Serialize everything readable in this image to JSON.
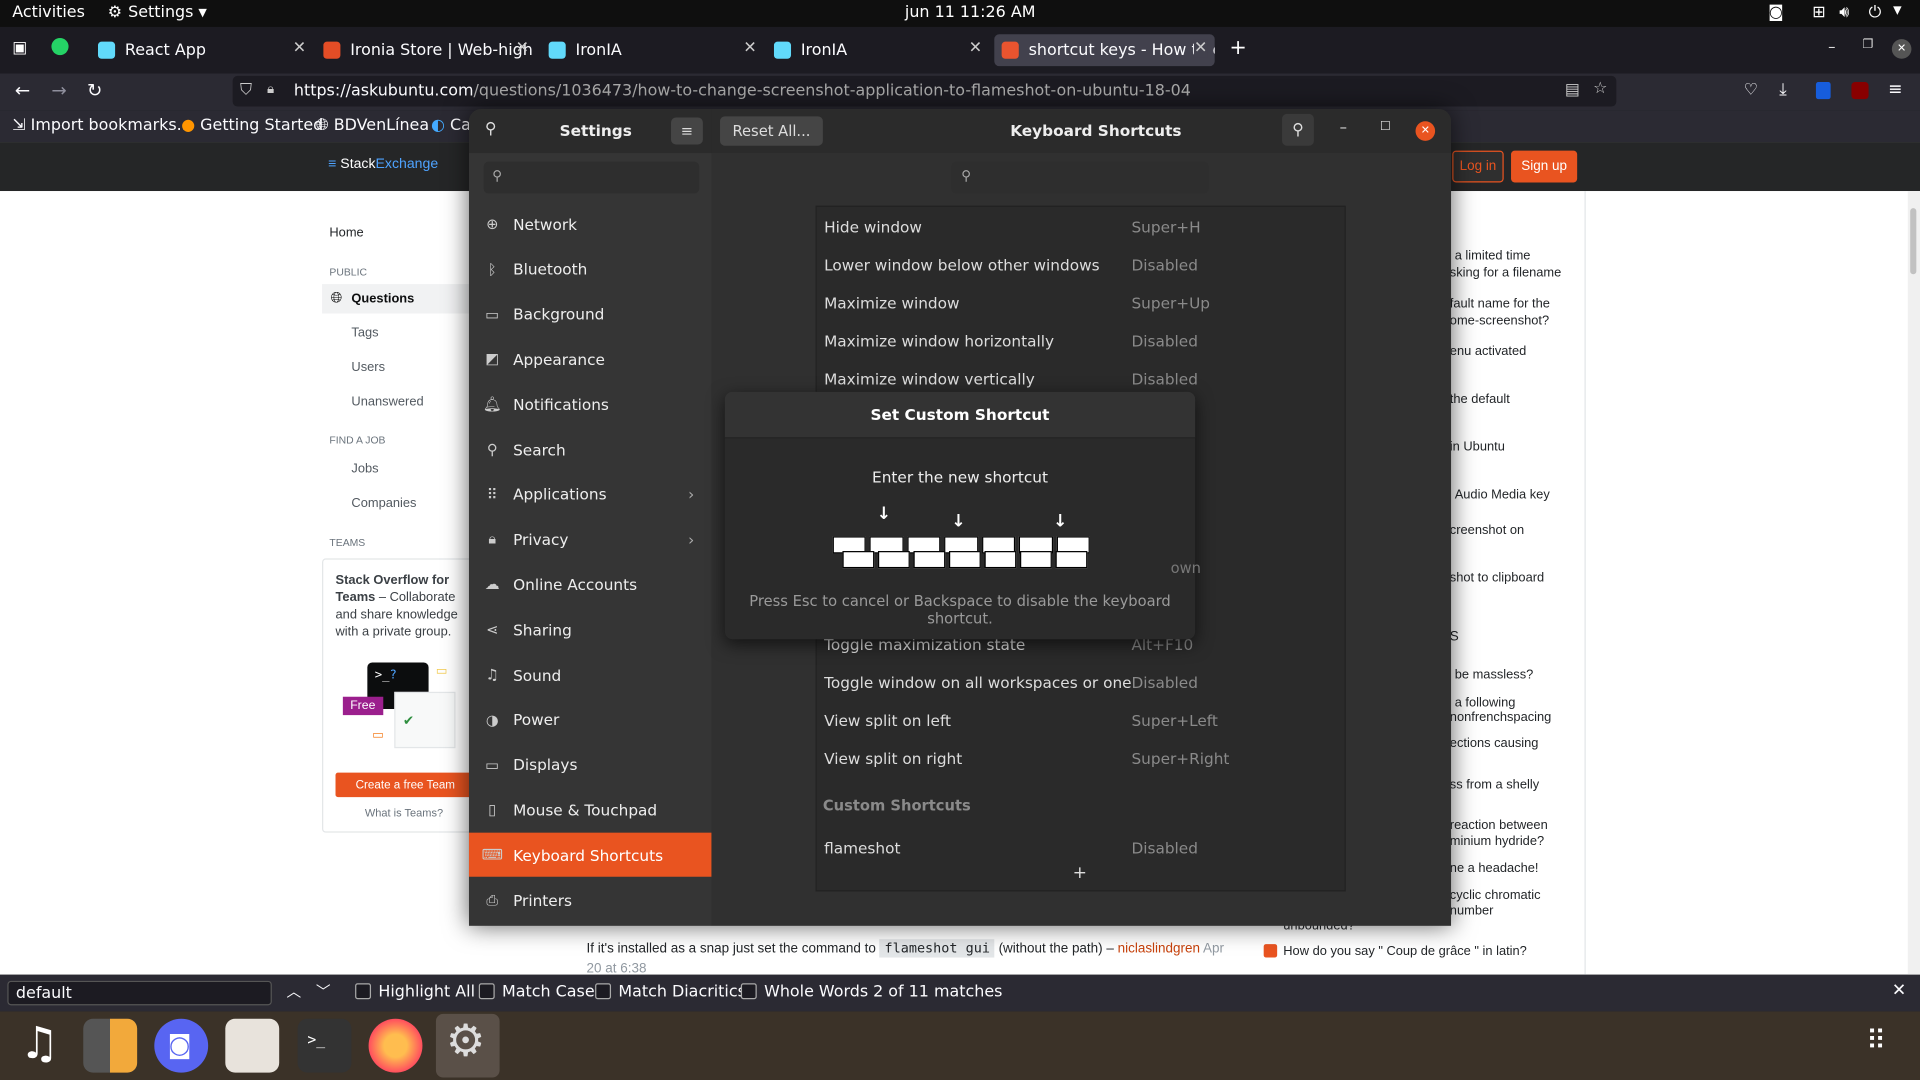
{
  "topbar": {
    "activities": "Activities",
    "app_menu": "Settings",
    "clock": "jun 11  11:26 AM"
  },
  "tabs": [
    {
      "label": "React App",
      "favicon_color": "#61dafb"
    },
    {
      "label": "Ironia Store | Web-high fi",
      "favicon_color": "#e44d26"
    },
    {
      "label": "IronIA",
      "favicon_color": "#61dafb"
    },
    {
      "label": "IronIA",
      "favicon_color": "#61dafb"
    },
    {
      "label": "shortcut keys - How to ch",
      "favicon_color": "#e9542f"
    }
  ],
  "url": {
    "host": "https://askubuntu.com",
    "path": "/questions/1036473/how-to-change-screenshot-application-to-flameshot-on-ubuntu-18-04"
  },
  "bookmarks": [
    "Import bookmarks...",
    "Getting Started",
    "BDVenLínea",
    "Cal"
  ],
  "se_header": {
    "brand_a": "Stack",
    "brand_b": "Exchange",
    "login": "Log in",
    "signup": "Sign up"
  },
  "se_nav": {
    "home": "Home",
    "public": "PUBLIC",
    "questions": "Questions",
    "tags": "Tags",
    "users": "Users",
    "unanswered": "Unanswered",
    "find_job": "FIND A JOB",
    "jobs": "Jobs",
    "companies": "Companies",
    "teams": "TEAMS",
    "teams_title": "Stack Overflow for Teams",
    "teams_desc": " – Collaborate and share knowledge with a private group.",
    "free_badge": "Free",
    "create_team": "Create a free Team",
    "what_teams": "What is Teams?"
  },
  "se_right": [
    "a limited time",
    "sking for a filename",
    "fault name for the",
    "ome-screenshot?",
    "enu activated",
    "the default",
    "in Ubuntu",
    "Audio Media key",
    "creenshot on",
    "shot to clipboard",
    "S",
    "be massless?",
    "a following",
    "nonfrenchspacing",
    "ections causing",
    "ss from a shelly",
    "reaction between",
    "minium hydride?",
    "ne a headache!",
    "cyclic chromatic",
    "number",
    "unbounded?",
    "How do you say \" Coup de grâce \" in latin?"
  ],
  "se_comment": {
    "pre": "If it's installed as a snap just set the command to ",
    "code": "flameshot gui",
    "post": " (without the path) – ",
    "user": "niclaslindgren",
    "date": "Apr",
    "date2": "20 at 6:38"
  },
  "settings": {
    "title": "Settings",
    "reset": "Reset All...",
    "panel_title": "Keyboard Shortcuts",
    "sidebar": [
      {
        "label": "Network",
        "icon": "network-icon"
      },
      {
        "label": "Bluetooth",
        "icon": "bluetooth-icon"
      },
      {
        "label": "Background",
        "icon": "background-icon"
      },
      {
        "label": "Appearance",
        "icon": "appearance-icon"
      },
      {
        "label": "Notifications",
        "icon": "bell-icon"
      },
      {
        "label": "Search",
        "icon": "search-icon"
      },
      {
        "label": "Applications",
        "icon": "apps-grid-icon",
        "arrow": "›"
      },
      {
        "label": "Privacy",
        "icon": "lock-icon",
        "arrow": "›"
      },
      {
        "label": "Online Accounts",
        "icon": "cloud-icon"
      },
      {
        "label": "Sharing",
        "icon": "share-icon"
      },
      {
        "label": "Sound",
        "icon": "music-note-icon"
      },
      {
        "label": "Power",
        "icon": "power-icon"
      },
      {
        "label": "Displays",
        "icon": "display-icon"
      },
      {
        "label": "Mouse & Touchpad",
        "icon": "mouse-icon"
      },
      {
        "label": "Keyboard Shortcuts",
        "icon": "keyboard-icon",
        "active": true
      },
      {
        "label": "Printers",
        "icon": "printer-icon"
      }
    ],
    "shortcuts_top": [
      {
        "name": "Hide window",
        "key": "Super+H"
      },
      {
        "name": "Lower window below other windows",
        "key": "Disabled"
      },
      {
        "name": "Maximize window",
        "key": "Super+Up"
      },
      {
        "name": "Maximize window horizontally",
        "key": "Disabled"
      },
      {
        "name": "Maximize window vertically",
        "key": "Disabled"
      }
    ],
    "hidden_fragment": "own",
    "shortcuts_bottom": [
      {
        "name": "Toggle maximization state",
        "key": "Alt+F10"
      },
      {
        "name": "Toggle window on all workspaces or one",
        "key": "Disabled"
      },
      {
        "name": "View split on left",
        "key": "Super+Left"
      },
      {
        "name": "View split on right",
        "key": "Super+Right"
      }
    ],
    "custom_header": "Custom Shortcuts",
    "custom": [
      {
        "name": "flameshot",
        "key": "Disabled"
      }
    ],
    "add_label": "+"
  },
  "dialog": {
    "title": "Set Custom Shortcut",
    "prompt": "Enter the new shortcut",
    "hint": "Press Esc to cancel or Backspace to disable the keyboard shortcut."
  },
  "find": {
    "value": "default",
    "highlight_all": "Highlight All",
    "match_case": "Match Case",
    "match_diacritics": "Match Diacritics",
    "whole_words": "Whole Words",
    "status": "2 of 11 matches"
  },
  "colors": {
    "accent": "#e95420",
    "se_orange": "#f48024",
    "se_blue": "#0a95ff"
  }
}
